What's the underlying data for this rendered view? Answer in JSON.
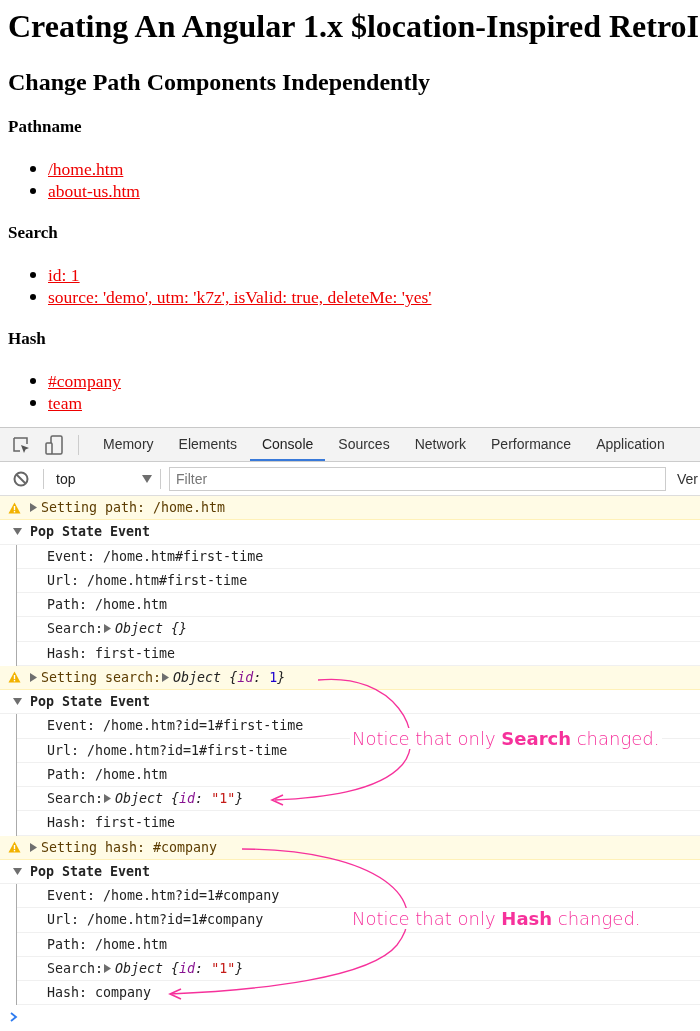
{
  "page": {
    "title": "Creating An Angular 1.x $location-Inspired RetroI",
    "subtitle": "Change Path Components Independently",
    "sections": [
      {
        "heading": "Pathname",
        "links": [
          "/home.htm",
          "about-us.htm"
        ]
      },
      {
        "heading": "Search",
        "links": [
          "id: 1",
          "source: 'demo', utm: 'k7z', isValid: true, deleteMe: 'yes'"
        ]
      },
      {
        "heading": "Hash",
        "links": [
          "#company",
          "team"
        ]
      }
    ]
  },
  "devtools": {
    "tabs": [
      {
        "label": "Memory",
        "selected": false
      },
      {
        "label": "Elements",
        "selected": false
      },
      {
        "label": "Console",
        "selected": true
      },
      {
        "label": "Sources",
        "selected": false
      },
      {
        "label": "Network",
        "selected": false
      },
      {
        "label": "Performance",
        "selected": false
      },
      {
        "label": "Application",
        "selected": false
      }
    ],
    "context": "top",
    "filter": {
      "placeholder": "Filter"
    },
    "levels_button": "Ver",
    "console": [
      {
        "kind": "warning",
        "expanded": false,
        "parts": [
          {
            "kind": "text",
            "text": "Setting path: /home.htm"
          }
        ]
      },
      {
        "kind": "group",
        "title": "Pop State Event",
        "expanded": true,
        "children": [
          {
            "parts": [
              {
                "kind": "text",
                "text": "Event: /home.htm#first-time"
              }
            ]
          },
          {
            "parts": [
              {
                "kind": "text",
                "text": "Url: /home.htm#first-time"
              }
            ]
          },
          {
            "parts": [
              {
                "kind": "text",
                "text": "Path: /home.htm"
              }
            ]
          },
          {
            "parts": [
              {
                "kind": "text",
                "text": "Search: "
              },
              {
                "kind": "object",
                "expanded": false,
                "parts": [
                  {
                    "kind": "italic",
                    "text": "Object {}"
                  }
                ]
              }
            ]
          },
          {
            "parts": [
              {
                "kind": "text",
                "text": "Hash: first-time"
              }
            ]
          }
        ]
      },
      {
        "kind": "warning",
        "expanded": false,
        "parts": [
          {
            "kind": "text",
            "text": "Setting search: "
          },
          {
            "kind": "object",
            "expanded": false,
            "parts": [
              {
                "kind": "italic",
                "text": "Object {"
              },
              {
                "kind": "key",
                "text": "id"
              },
              {
                "kind": "italic",
                "text": ": "
              },
              {
                "kind": "number",
                "text": "1"
              },
              {
                "kind": "italic",
                "text": "}"
              }
            ]
          }
        ]
      },
      {
        "kind": "group",
        "title": "Pop State Event",
        "expanded": true,
        "children": [
          {
            "parts": [
              {
                "kind": "text",
                "text": "Event: /home.htm?id=1#first-time"
              }
            ]
          },
          {
            "parts": [
              {
                "kind": "text",
                "text": "Url: /home.htm?id=1#first-time"
              }
            ]
          },
          {
            "parts": [
              {
                "kind": "text",
                "text": "Path: /home.htm"
              }
            ]
          },
          {
            "parts": [
              {
                "kind": "text",
                "text": "Search: "
              },
              {
                "kind": "object",
                "expanded": false,
                "parts": [
                  {
                    "kind": "italic",
                    "text": "Object {"
                  },
                  {
                    "kind": "key",
                    "text": "id"
                  },
                  {
                    "kind": "italic",
                    "text": ": "
                  },
                  {
                    "kind": "string",
                    "text": "\"1\""
                  },
                  {
                    "kind": "italic",
                    "text": "}"
                  }
                ]
              }
            ]
          },
          {
            "parts": [
              {
                "kind": "text",
                "text": "Hash: first-time"
              }
            ]
          }
        ]
      },
      {
        "kind": "warning",
        "expanded": false,
        "parts": [
          {
            "kind": "text",
            "text": "Setting hash: #company"
          }
        ]
      },
      {
        "kind": "group",
        "title": "Pop State Event",
        "expanded": true,
        "children": [
          {
            "parts": [
              {
                "kind": "text",
                "text": "Event: /home.htm?id=1#company"
              }
            ]
          },
          {
            "parts": [
              {
                "kind": "text",
                "text": "Url: /home.htm?id=1#company"
              }
            ]
          },
          {
            "parts": [
              {
                "kind": "text",
                "text": "Path: /home.htm"
              }
            ]
          },
          {
            "parts": [
              {
                "kind": "text",
                "text": "Search: "
              },
              {
                "kind": "object",
                "expanded": false,
                "parts": [
                  {
                    "kind": "italic",
                    "text": "Object {"
                  },
                  {
                    "kind": "key",
                    "text": "id"
                  },
                  {
                    "kind": "italic",
                    "text": ": "
                  },
                  {
                    "kind": "string",
                    "text": "\"1\""
                  },
                  {
                    "kind": "italic",
                    "text": "}"
                  }
                ]
              }
            ]
          },
          {
            "parts": [
              {
                "kind": "text",
                "text": "Hash: company"
              }
            ]
          }
        ]
      }
    ]
  },
  "annotations": [
    {
      "text": "Notice that only **Search** changed."
    },
    {
      "text": "Notice that only **Hash** changed."
    }
  ]
}
